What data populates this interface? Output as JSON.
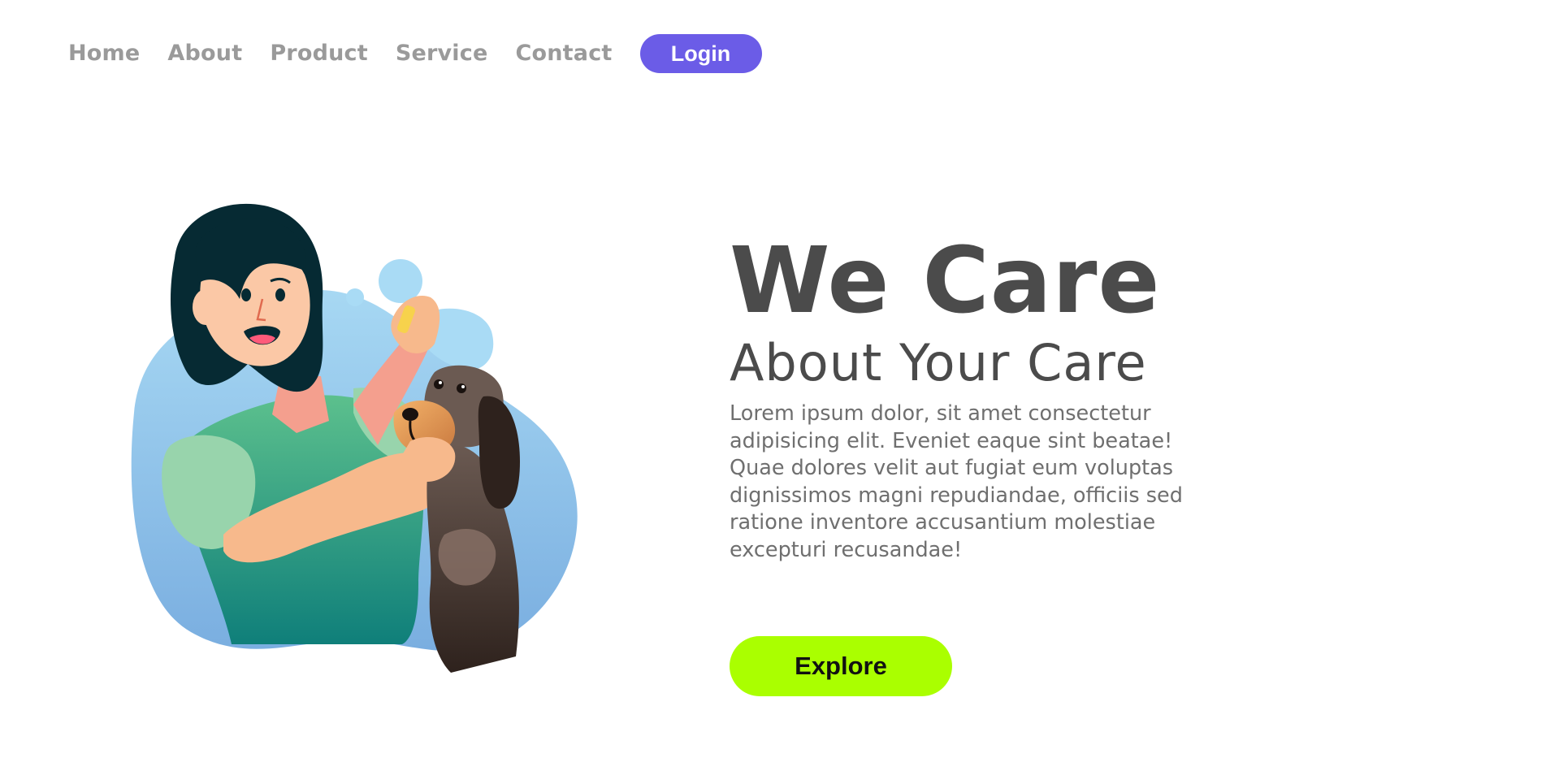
{
  "nav": {
    "links": [
      "Home",
      "About",
      "Product",
      "Service",
      "Contact"
    ],
    "login_label": "Login"
  },
  "hero": {
    "title": "We Care",
    "subtitle": "About Your Care",
    "body": "Lorem ipsum dolor, sit amet consectetur adipisicing elit. Eveniet eaque sint beatae! Quae dolores velit aut fugiat eum voluptas dignissimos magni repudiandae, officiis sed ratione inventore accusantium molestiae excepturi recusandae!",
    "cta_label": "Explore"
  },
  "colors": {
    "login_button": "#6b5ce7",
    "explore_button": "#aaff00",
    "nav_text": "#9a9a9a",
    "heading_text": "#4b4b4b",
    "body_text": "#6f6f6f"
  },
  "illustration": {
    "subject": "woman-putting-eye-drops-on-dog"
  }
}
